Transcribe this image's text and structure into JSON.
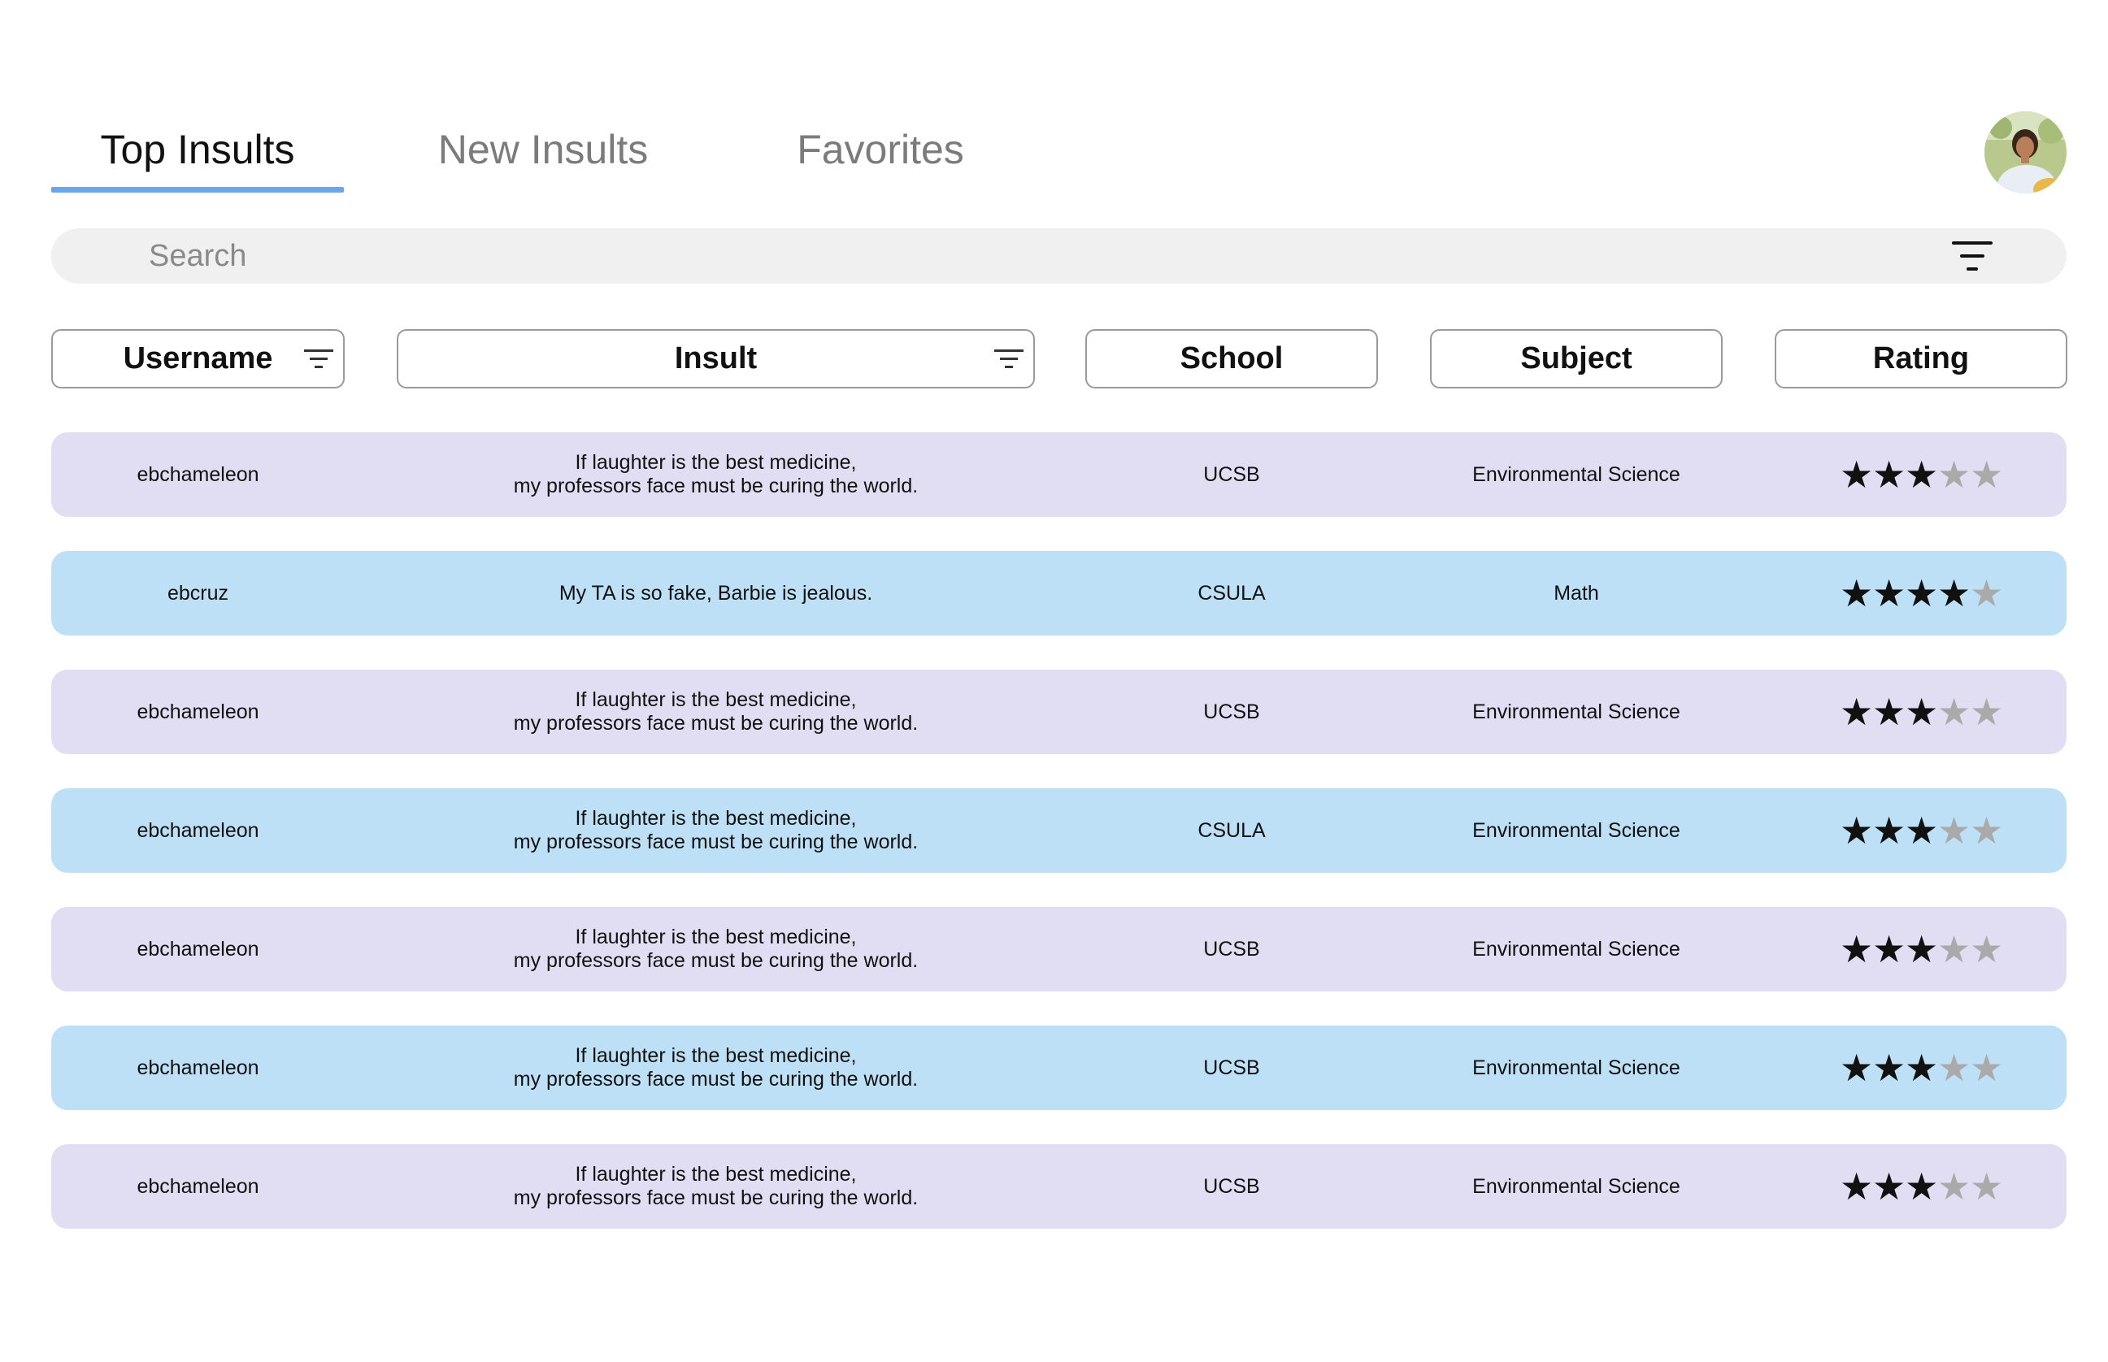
{
  "tabs": [
    {
      "label": "Top Insults",
      "active": true
    },
    {
      "label": "New Insults",
      "active": false
    },
    {
      "label": "Favorites",
      "active": false
    }
  ],
  "avatar": {
    "icon": "user-avatar-photo"
  },
  "search": {
    "placeholder": "Search",
    "value": ""
  },
  "columns": {
    "username": "Username",
    "insult": "Insult",
    "school": "School",
    "subject": "Subject",
    "rating": "Rating"
  },
  "colors": {
    "tab_underline": "#6ea4ee",
    "row_lavender": "#e1def4",
    "row_blue": "#bde0f7"
  },
  "rows": [
    {
      "username": "ebchameleon",
      "insult_line1": "If laughter is the best medicine,",
      "insult_line2": "my professors face must be curing the world.",
      "school": "UCSB",
      "subject": "Environmental Science",
      "rating": 3,
      "max_rating": 5
    },
    {
      "username": "ebcruz",
      "insult_line1": "My TA is so fake, Barbie is jealous.",
      "insult_line2": "",
      "school": "CSULA",
      "subject": "Math",
      "rating": 4,
      "max_rating": 5
    },
    {
      "username": "ebchameleon",
      "insult_line1": "If laughter is the best medicine,",
      "insult_line2": "my professors face must be curing the world.",
      "school": "UCSB",
      "subject": "Environmental Science",
      "rating": 3,
      "max_rating": 5
    },
    {
      "username": "ebchameleon",
      "insult_line1": "If laughter is the best medicine,",
      "insult_line2": "my professors face must be curing the world.",
      "school": "CSULA",
      "subject": "Environmental Science",
      "rating": 3,
      "max_rating": 5
    },
    {
      "username": "ebchameleon",
      "insult_line1": "If laughter is the best medicine,",
      "insult_line2": "my professors face must be curing the world.",
      "school": "UCSB",
      "subject": "Environmental Science",
      "rating": 3,
      "max_rating": 5
    },
    {
      "username": "ebchameleon",
      "insult_line1": "If laughter is the best medicine,",
      "insult_line2": "my professors face must be curing the world.",
      "school": "UCSB",
      "subject": "Environmental Science",
      "rating": 3,
      "max_rating": 5
    },
    {
      "username": "ebchameleon",
      "insult_line1": "If laughter is the best medicine,",
      "insult_line2": "my professors face must be curing the world.",
      "school": "UCSB",
      "subject": "Environmental Science",
      "rating": 3,
      "max_rating": 5
    }
  ]
}
